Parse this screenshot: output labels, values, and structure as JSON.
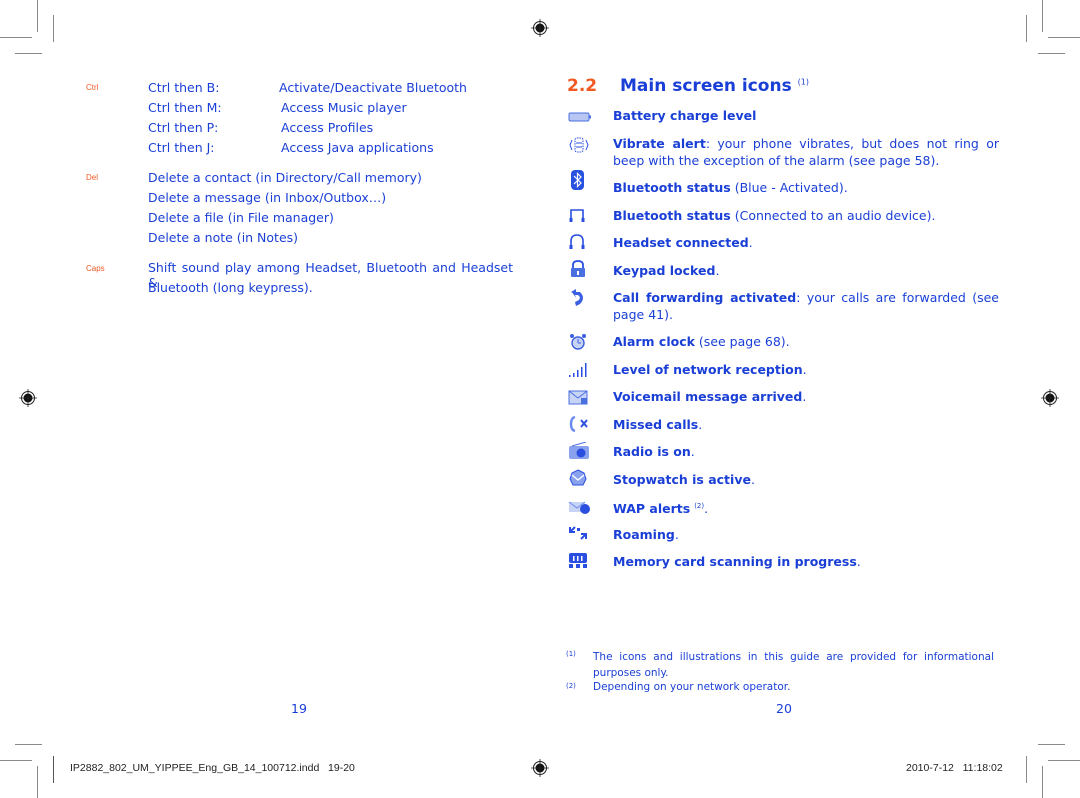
{
  "left_page": {
    "groups": [
      {
        "key_label": "Ctrl",
        "rows": [
          {
            "shortcut": "Ctrl then B:",
            "action": "Activate/Deactivate Bluetooth"
          },
          {
            "shortcut": "Ctrl then M:",
            "action": "Access Music player"
          },
          {
            "shortcut": "Ctrl then P:",
            "action": "Access Profiles"
          },
          {
            "shortcut": "Ctrl then J:",
            "action": "Access Java applications"
          }
        ]
      },
      {
        "key_label": "Del",
        "lines": [
          "Delete a contact (in Directory/Call memory)",
          "Delete a message (in Inbox/Outbox…)",
          "Delete a file (in File manager)",
          "Delete a note (in Notes)"
        ]
      },
      {
        "key_label": "Caps",
        "lines": [
          "Shift sound play among Headset, Bluetooth and Headset &",
          "Bluetooth (long keypress)."
        ]
      }
    ],
    "page_number": "19"
  },
  "right_page": {
    "section_number": "2.2",
    "section_title": "Main screen icons",
    "section_footnote_ref": "(1)",
    "items": [
      {
        "icon": "battery-icon",
        "bold": "Battery charge level",
        "rest": ""
      },
      {
        "icon": "vibrate-icon",
        "bold": "Vibrate alert",
        "rest": ": your phone vibrates, but does not ring or beep with the exception of the alarm (see page 58)."
      },
      {
        "icon": "bluetooth-icon",
        "bold": "Bluetooth status",
        "rest": " (Blue - Activated)."
      },
      {
        "icon": "bluetooth-audio-icon",
        "bold": "Bluetooth status",
        "rest": " (Connected to an audio device)."
      },
      {
        "icon": "headset-icon",
        "bold": "Headset connected",
        "rest": "."
      },
      {
        "icon": "lock-icon",
        "bold": "Keypad locked",
        "rest": "."
      },
      {
        "icon": "call-forward-icon",
        "bold": "Call forwarding activated",
        "rest": ": your calls are forwarded (see page 41)."
      },
      {
        "icon": "alarm-clock-icon",
        "bold": "Alarm clock",
        "rest": " (see page 68)."
      },
      {
        "icon": "signal-icon",
        "bold": "Level of network reception",
        "rest": "."
      },
      {
        "icon": "voicemail-icon",
        "bold": "Voicemail message arrived",
        "rest": "."
      },
      {
        "icon": "missed-call-icon",
        "bold": "Missed calls",
        "rest": "."
      },
      {
        "icon": "radio-icon",
        "bold": "Radio is on",
        "rest": "."
      },
      {
        "icon": "stopwatch-icon",
        "bold": "Stopwatch is active",
        "rest": "."
      },
      {
        "icon": "wap-alert-icon",
        "bold": "WAP alerts",
        "sup": "(2)",
        "rest": "."
      },
      {
        "icon": "roaming-icon",
        "bold": "Roaming",
        "rest": "."
      },
      {
        "icon": "memory-card-icon",
        "bold": "Memory card scanning in progress",
        "rest": "."
      }
    ],
    "footnotes": [
      {
        "ref": "(1)",
        "text": "The icons and illustrations in this guide are provided for informational purposes only."
      },
      {
        "ref": "(2)",
        "text": "Depending on your network operator."
      }
    ],
    "page_number": "20"
  },
  "slug": {
    "filename": "IP2882_802_UM_YIPPEE_Eng_GB_14_100712.indd   19-20",
    "timestamp": "2010-7-12   11:18:02"
  }
}
